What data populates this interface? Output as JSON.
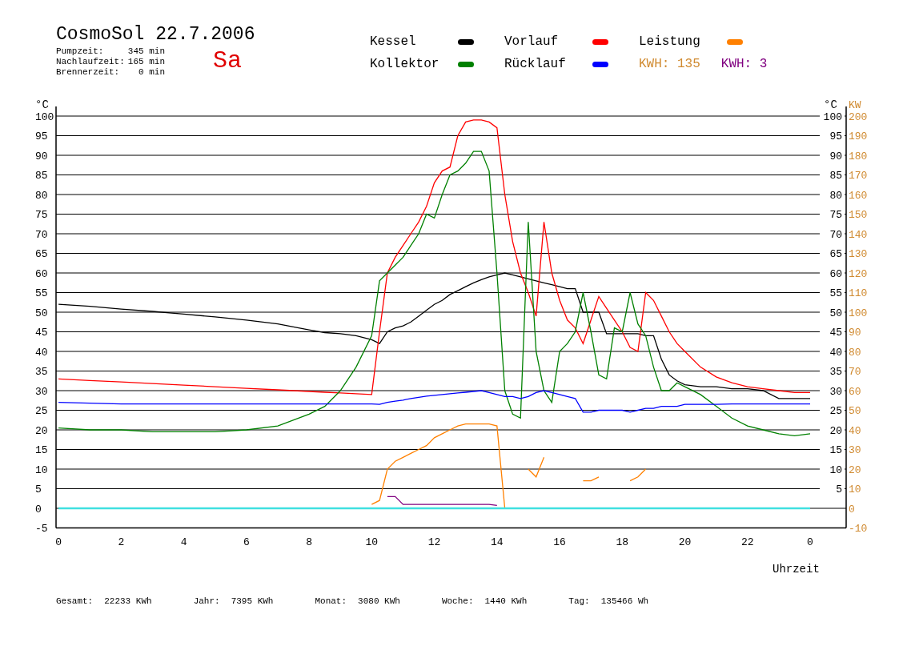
{
  "header": {
    "title": "CosmoSol 22.7.2006",
    "weekday": "Sa",
    "stats": [
      {
        "label": "Pumpzeit:",
        "value": "345 min"
      },
      {
        "label": "Nachlaufzeit:",
        "value": "165 min"
      },
      {
        "label": "Brennerzeit:",
        "value": "0 min"
      }
    ]
  },
  "energy": [
    {
      "text": "KWH: 135",
      "color": "#d08a30"
    },
    {
      "text": "KWH: 3",
      "color": "#800080"
    }
  ],
  "chart": {
    "day_end_label": "0",
    "right_scale": {
      "unit": "°C",
      "ticks": [
        "100",
        "95",
        "90",
        "85",
        "80",
        "75",
        "70",
        "65",
        "60",
        "55",
        "50",
        "45",
        "40",
        "35",
        "30",
        "25",
        "20",
        "15",
        "10",
        "5"
      ]
    },
    "chart_data": {
      "type": "line",
      "xlabel": "Uhrzeit",
      "ylabel": "°C",
      "y2label": "KW",
      "xlim": [
        -0.08,
        25.15
      ],
      "ylim": [
        -5,
        100
      ],
      "y2lim": [
        -10,
        200
      ],
      "xticks": [
        0,
        2,
        4,
        6,
        8,
        10,
        12,
        14,
        16,
        18,
        20,
        22
      ],
      "yticks": [
        -5,
        0,
        5,
        10,
        15,
        20,
        25,
        30,
        35,
        40,
        45,
        50,
        55,
        60,
        65,
        70,
        75,
        80,
        85,
        90,
        95,
        100
      ],
      "y2ticks": [
        -10,
        0,
        10,
        20,
        30,
        40,
        50,
        60,
        70,
        80,
        90,
        100,
        110,
        120,
        130,
        140,
        150,
        160,
        170,
        180,
        190,
        200
      ],
      "x": [
        0,
        1,
        2,
        3,
        4,
        5,
        6,
        7,
        8,
        8.5,
        9,
        9.5,
        10,
        10.25,
        10.5,
        10.75,
        11,
        11.25,
        11.5,
        11.75,
        12,
        12.25,
        12.5,
        12.75,
        13,
        13.25,
        13.5,
        13.75,
        14,
        14.25,
        14.5,
        14.75,
        15,
        15.25,
        15.5,
        15.75,
        16,
        16.25,
        16.5,
        16.75,
        17,
        17.25,
        17.5,
        17.75,
        18,
        18.25,
        18.5,
        18.75,
        19,
        19.25,
        19.5,
        19.75,
        20,
        20.5,
        21,
        21.5,
        22,
        22.5,
        23,
        23.5,
        24
      ],
      "series": [
        {
          "name": "Kessel",
          "color": "#000000",
          "values": [
            52,
            51.5,
            50.8,
            50.2,
            49.5,
            48.8,
            48,
            47,
            45.5,
            44.8,
            44.5,
            44,
            43,
            42,
            45,
            46,
            46.5,
            47.5,
            49,
            50.5,
            52,
            53,
            54.5,
            55.5,
            56.5,
            57.5,
            58.3,
            59,
            59.5,
            60,
            59.5,
            59,
            58.5,
            58,
            57.5,
            57,
            56.5,
            56,
            56,
            50,
            50,
            50,
            44.5,
            44.5,
            44.5,
            44.5,
            44.5,
            44,
            44,
            38,
            34,
            32.5,
            31.5,
            31,
            31,
            30.5,
            30.5,
            30,
            28,
            28,
            28
          ]
        },
        {
          "name": "Vorlauf",
          "color": "#ff0000",
          "values": [
            33,
            32.6,
            32.2,
            31.8,
            31.4,
            31,
            30.6,
            30.2,
            29.8,
            29.6,
            29.4,
            29.2,
            29,
            45,
            60,
            64,
            67,
            70,
            73,
            77,
            83,
            86,
            87,
            95,
            98.5,
            99,
            99,
            98.5,
            97,
            80,
            68,
            60,
            55,
            49,
            73,
            60,
            53,
            48,
            46,
            42,
            48,
            54,
            51,
            48,
            45,
            41,
            40,
            55,
            53,
            49,
            45,
            42,
            40,
            36,
            33.5,
            32,
            31,
            30.5,
            30,
            29.5,
            29.5
          ]
        },
        {
          "name": "Leistung",
          "color": "#ff8000",
          "axis": "y2",
          "values": [
            null,
            null,
            null,
            null,
            null,
            null,
            null,
            null,
            null,
            null,
            null,
            null,
            2,
            4,
            20,
            24,
            26,
            28,
            30,
            32,
            36,
            38,
            40,
            42,
            43,
            43,
            43,
            43,
            42,
            0,
            null,
            null,
            20,
            16,
            26,
            null,
            null,
            null,
            null,
            14,
            14,
            16,
            null,
            null,
            null,
            14,
            16,
            20,
            null,
            null,
            null,
            null,
            null,
            null,
            null,
            null,
            null,
            null,
            null,
            null,
            null
          ]
        },
        {
          "name": "Kollektor",
          "color": "#008000",
          "values": [
            20.5,
            20,
            20,
            19.5,
            19.5,
            19.5,
            20,
            21,
            24,
            26,
            30,
            36,
            44,
            58,
            60,
            62,
            64,
            67,
            70,
            75,
            74,
            80,
            85,
            86,
            88,
            91,
            91,
            86,
            60,
            30,
            24,
            23,
            73,
            40,
            30,
            27,
            40,
            42,
            45,
            55,
            45,
            34,
            33,
            46,
            45,
            55,
            47,
            44,
            36,
            30,
            30,
            32,
            31,
            29,
            26,
            23,
            21,
            20,
            19,
            18.5,
            19
          ]
        },
        {
          "name": "Rücklauf",
          "color": "#0000ff",
          "values": [
            27,
            26.8,
            26.6,
            26.6,
            26.6,
            26.6,
            26.6,
            26.6,
            26.6,
            26.6,
            26.6,
            26.6,
            26.6,
            26.5,
            27,
            27.3,
            27.6,
            28,
            28.3,
            28.6,
            28.8,
            29,
            29.2,
            29.4,
            29.6,
            29.8,
            30,
            29.5,
            29,
            28.5,
            28.5,
            28,
            28.5,
            29.5,
            30,
            29.5,
            29,
            28.5,
            28,
            24.5,
            24.5,
            25,
            25,
            25,
            25,
            24.5,
            25,
            25.5,
            25.5,
            26,
            26,
            26,
            26.5,
            26.5,
            26.5,
            26.6,
            26.6,
            26.6,
            26.6,
            26.6,
            26.6
          ]
        },
        {
          "color": "#800080",
          "axis": "y2",
          "values": [
            null,
            null,
            null,
            null,
            null,
            null,
            null,
            null,
            null,
            null,
            null,
            null,
            null,
            null,
            6,
            6,
            2,
            2,
            2,
            2,
            2,
            2,
            2,
            2,
            2,
            2,
            2,
            2,
            1.5,
            null,
            null,
            null,
            null,
            null,
            null,
            null,
            null,
            null,
            null,
            null,
            null,
            null,
            null,
            null,
            null,
            null,
            null,
            null,
            null,
            null,
            null,
            null,
            null,
            null,
            null,
            null,
            null,
            null,
            null,
            null,
            null
          ]
        },
        {
          "color": "#40e0e0",
          "values": [
            0,
            0,
            0,
            0,
            0,
            0,
            0,
            0,
            0,
            0,
            0,
            0,
            0,
            0,
            0,
            0,
            0,
            0,
            0,
            0,
            0,
            0,
            0,
            0,
            0,
            0,
            0,
            0,
            0,
            0,
            0,
            0,
            0,
            0,
            0,
            0,
            0,
            0,
            0,
            0,
            0,
            0,
            0,
            0,
            0,
            0,
            0,
            0,
            0,
            0,
            0,
            0,
            0,
            0,
            0,
            0,
            0,
            0,
            0,
            0,
            0
          ]
        }
      ]
    }
  },
  "footer": [
    {
      "label": "Gesamt:",
      "value": "22233 KWh"
    },
    {
      "label": "Jahr:",
      "value": "7395 KWh"
    },
    {
      "label": "Monat:",
      "value": "3080 KWh"
    },
    {
      "label": "Woche:",
      "value": "1440 KWh"
    },
    {
      "label": "Tag:",
      "value": "135466 Wh"
    }
  ]
}
